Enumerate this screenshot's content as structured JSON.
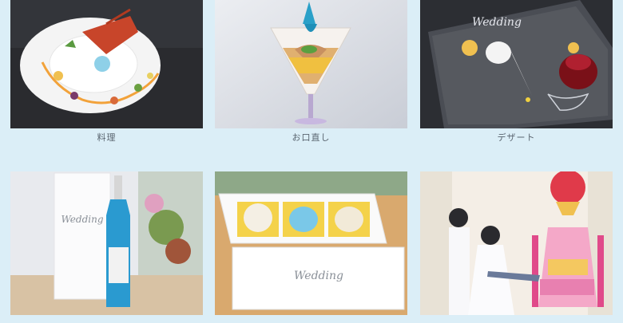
{
  "gallery": {
    "items": [
      {
        "caption": "料理",
        "icon": "dish-photo"
      },
      {
        "caption": "お口直し",
        "icon": "palate-cleanser-photo"
      },
      {
        "caption": "デザート",
        "icon": "dessert-photo"
      },
      {
        "caption": "",
        "icon": "drink-photo"
      },
      {
        "caption": "",
        "icon": "sweets-box-photo"
      },
      {
        "caption": "",
        "icon": "wedding-cake-photo"
      }
    ],
    "brand_text": "Wedding",
    "colors": {
      "background": "#dbeef7",
      "caption": "#5a6570"
    }
  }
}
